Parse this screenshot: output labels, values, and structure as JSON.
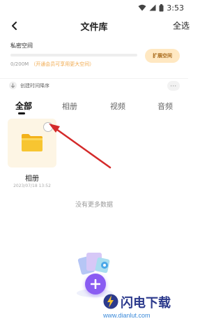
{
  "status_bar": {
    "time": "3:53"
  },
  "header": {
    "title": "文件库",
    "select_all_label": "全选"
  },
  "private_space": {
    "title": "私密空间",
    "used_text": "0/200M",
    "hint": "（开通会员可享用更大空间）",
    "expand_label": "扩展空间",
    "usage_fraction": 0.0
  },
  "sort": {
    "label": "创建时间降序",
    "more_icon": "more-icon"
  },
  "tabs": [
    {
      "label": "全部",
      "active": true
    },
    {
      "label": "相册",
      "active": false
    },
    {
      "label": "视频",
      "active": false
    },
    {
      "label": "音频",
      "active": false
    }
  ],
  "folders": [
    {
      "name": "相册",
      "date": "2023/07/18 13:52",
      "icon": "folder-icon"
    }
  ],
  "empty_message": "没有更多数据",
  "watermark": {
    "brand": "闪电下载",
    "url": "www.dianlut.com"
  },
  "colors": {
    "accent_orange": "#f0a84b",
    "expand_button_bg": "#ffe8c2",
    "folder_yellow": "#f7c531",
    "fab_purple": "#8a5cf2",
    "annotation_arrow": "#d42a2a"
  }
}
